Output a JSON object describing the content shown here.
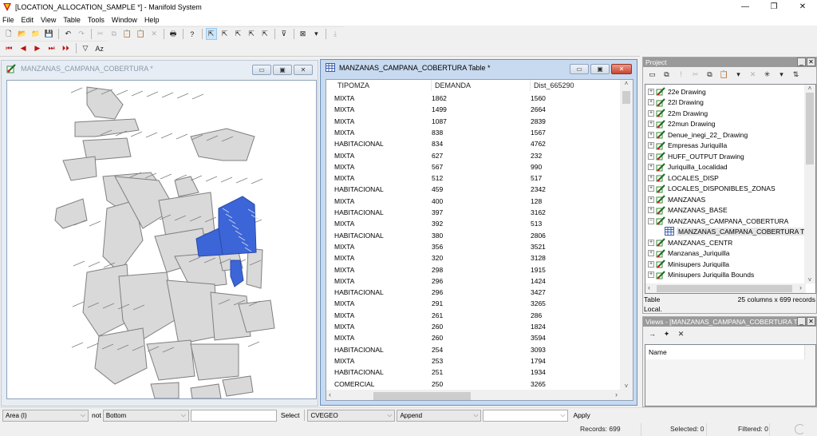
{
  "app": {
    "title": "[LOCATION_ALLOCATION_SAMPLE *] - Manifold System",
    "icon": "manifold-logo-icon",
    "window_controls": {
      "minimize": "—",
      "maximize": "❐",
      "close": "✕"
    }
  },
  "menu": [
    "File",
    "Edit",
    "View",
    "Table",
    "Tools",
    "Window",
    "Help"
  ],
  "toolbar1": [
    {
      "name": "new-icon",
      "glyph": "🗋"
    },
    {
      "name": "open-icon",
      "glyph": "📂"
    },
    {
      "name": "open-folder-icon",
      "glyph": "📁"
    },
    {
      "name": "save-icon",
      "glyph": "💾"
    },
    {
      "sep": true
    },
    {
      "name": "undo-icon",
      "glyph": "↶"
    },
    {
      "name": "redo-icon",
      "glyph": "↷",
      "disabled": true
    },
    {
      "sep": true
    },
    {
      "name": "cut-icon",
      "glyph": "✂",
      "disabled": true
    },
    {
      "name": "copy-icon",
      "glyph": "⧉",
      "disabled": true
    },
    {
      "name": "paste-icon",
      "glyph": "📋",
      "disabled": true
    },
    {
      "name": "paste-special-icon",
      "glyph": "📋",
      "disabled": true
    },
    {
      "name": "delete-icon",
      "glyph": "✕",
      "disabled": true
    },
    {
      "sep": true
    },
    {
      "name": "print-icon",
      "glyph": "🖶"
    },
    {
      "sep": true
    },
    {
      "name": "help-icon",
      "glyph": "?"
    },
    {
      "sep": true
    },
    {
      "name": "select-pointer-icon",
      "glyph": "⇱",
      "active": true
    },
    {
      "name": "select-add-icon",
      "glyph": "⇱"
    },
    {
      "name": "select-subtract-icon",
      "glyph": "⇱"
    },
    {
      "name": "select-toggle-icon",
      "glyph": "⇱"
    },
    {
      "name": "select-intersect-icon",
      "glyph": "⇱"
    },
    {
      "sep": true
    },
    {
      "name": "clear-filter-icon",
      "glyph": "⊽"
    },
    {
      "sep": true
    },
    {
      "name": "clear-selection-icon",
      "glyph": "⊠"
    },
    {
      "name": "dropdown-icon",
      "glyph": "▾"
    },
    {
      "sep": true
    },
    {
      "name": "remove-icon",
      "glyph": "⤓",
      "disabled": true
    }
  ],
  "toolbar2": [
    {
      "name": "first-record-icon",
      "glyph": "⏮"
    },
    {
      "name": "previous-record-icon",
      "glyph": "◀"
    },
    {
      "name": "next-record-icon",
      "glyph": "▶"
    },
    {
      "name": "last-record-icon",
      "glyph": "⏭"
    },
    {
      "name": "new-record-icon",
      "glyph": "⏵⏵",
      "disabled": true
    },
    {
      "sep": true
    },
    {
      "name": "filter-icon",
      "glyph": "▽"
    },
    {
      "name": "sort-icon",
      "glyph": "Aᴢ"
    }
  ],
  "map_window": {
    "title": "MANZANAS_CAMPANA_COBERTURA *",
    "icon": "drawing-icon",
    "fill_color": "#d9d9d9",
    "stroke_color": "#7f7f7f",
    "selected_color": "#3c65d8"
  },
  "table_window": {
    "title": "MANZANAS_CAMPANA_COBERTURA Table *",
    "icon": "table-icon",
    "columns": [
      "TIPOMZA",
      "DEMANDA",
      "Dist_665290"
    ],
    "rows": [
      [
        "MIXTA",
        "1862",
        "1560"
      ],
      [
        "MIXTA",
        "1499",
        "2664"
      ],
      [
        "MIXTA",
        "1087",
        "2839"
      ],
      [
        "MIXTA",
        "838",
        "1567"
      ],
      [
        "HABITACIONAL",
        "834",
        "4762"
      ],
      [
        "MIXTA",
        "627",
        "232"
      ],
      [
        "MIXTA",
        "567",
        "990"
      ],
      [
        "MIXTA",
        "512",
        "517"
      ],
      [
        "HABITACIONAL",
        "459",
        "2342"
      ],
      [
        "MIXTA",
        "400",
        "128"
      ],
      [
        "HABITACIONAL",
        "397",
        "3162"
      ],
      [
        "MIXTA",
        "392",
        "513"
      ],
      [
        "HABITACIONAL",
        "380",
        "2806"
      ],
      [
        "MIXTA",
        "356",
        "3521"
      ],
      [
        "MIXTA",
        "320",
        "3128"
      ],
      [
        "MIXTA",
        "298",
        "1915"
      ],
      [
        "MIXTA",
        "296",
        "1424"
      ],
      [
        "HABITACIONAL",
        "296",
        "3427"
      ],
      [
        "MIXTA",
        "291",
        "3265"
      ],
      [
        "MIXTA",
        "261",
        "286"
      ],
      [
        "MIXTA",
        "260",
        "1824"
      ],
      [
        "MIXTA",
        "260",
        "3594"
      ],
      [
        "HABITACIONAL",
        "254",
        "3093"
      ],
      [
        "MIXTA",
        "253",
        "1794"
      ],
      [
        "HABITACIONAL",
        "251",
        "1934"
      ],
      [
        "COMERCIAL",
        "250",
        "3265"
      ]
    ]
  },
  "project_panel": {
    "title": "Project",
    "toolbar": [
      {
        "name": "open-window-icon",
        "glyph": "▭"
      },
      {
        "name": "open-in-new-window-icon",
        "glyph": "⧉"
      },
      {
        "name": "exclamation-icon",
        "glyph": "!",
        "disabled": true
      },
      {
        "name": "cut-icon",
        "glyph": "✂",
        "disabled": true
      },
      {
        "name": "copy-icon",
        "glyph": "⧉"
      },
      {
        "name": "paste-icon",
        "glyph": "📋"
      },
      {
        "name": "dropdown-icon",
        "glyph": "▾"
      },
      {
        "name": "delete-icon",
        "glyph": "✕",
        "disabled": true
      },
      {
        "name": "new-component-icon",
        "glyph": "✳"
      },
      {
        "name": "dropdown-icon",
        "glyph": "▾"
      },
      {
        "name": "refresh-icon",
        "glyph": "⇅"
      }
    ],
    "items": [
      {
        "label": "22e Drawing",
        "type": "drawing",
        "expander": "+"
      },
      {
        "label": "22l Drawing",
        "type": "drawing",
        "expander": "+"
      },
      {
        "label": "22m Drawing",
        "type": "drawing",
        "expander": "+"
      },
      {
        "label": "22mun Drawing",
        "type": "drawing",
        "expander": "+"
      },
      {
        "label": "Denue_inegi_22_ Drawing",
        "type": "drawing",
        "expander": "+"
      },
      {
        "label": "Empresas Juriquilla",
        "type": "drawing",
        "expander": "+"
      },
      {
        "label": "HUFF_OUTPUT Drawing",
        "type": "drawing",
        "expander": "+"
      },
      {
        "label": "Juriquilla_Localidad",
        "type": "drawing",
        "expander": "+"
      },
      {
        "label": "LOCALES_DISP",
        "type": "drawing",
        "expander": "+"
      },
      {
        "label": "LOCALES_DISPONIBLES_ZONAS",
        "type": "drawing",
        "expander": "+"
      },
      {
        "label": "MANZANAS",
        "type": "drawing",
        "expander": "+"
      },
      {
        "label": "MANZANAS_BASE",
        "type": "drawing",
        "expander": "+"
      },
      {
        "label": "MANZANAS_CAMPANA_COBERTURA",
        "type": "drawing",
        "expander": "−"
      },
      {
        "label": "MANZANAS_CAMPANA_COBERTURA T",
        "type": "table",
        "child": true,
        "selected": true
      },
      {
        "label": "MANZANAS_CENTR",
        "type": "drawing",
        "expander": "+"
      },
      {
        "label": "Manzanas_Juriquilla",
        "type": "drawing",
        "expander": "+"
      },
      {
        "label": "Minisupers Juriquilla",
        "type": "drawing",
        "expander": "+"
      },
      {
        "label": "Minisupers Juriquilla Bounds",
        "type": "drawing",
        "expander": "+"
      }
    ],
    "info_type": "Table",
    "info_size": "25 columns x 699 records",
    "info_location": "Local."
  },
  "views_panel": {
    "title": "Views - [MANZANAS_CAMPANA_COBERTURA Ta",
    "column_header": "Name",
    "toolbar": [
      {
        "name": "apply-view-icon",
        "glyph": "→"
      },
      {
        "name": "add-view-icon",
        "glyph": "✦"
      },
      {
        "name": "delete-view-icon",
        "glyph": "✕"
      }
    ]
  },
  "query_bar": {
    "field_combo": "Area (I)",
    "not_label": "not",
    "operator_combo": "Bottom",
    "value_input": "",
    "select_button": "Select",
    "column_combo": "CVEGEO",
    "mode_combo": "Append",
    "expression_combo": "",
    "apply_button": "Apply"
  },
  "status": {
    "records": "Records: 699",
    "selected": "Selected: 0",
    "filtered": "Filtered: 0"
  }
}
